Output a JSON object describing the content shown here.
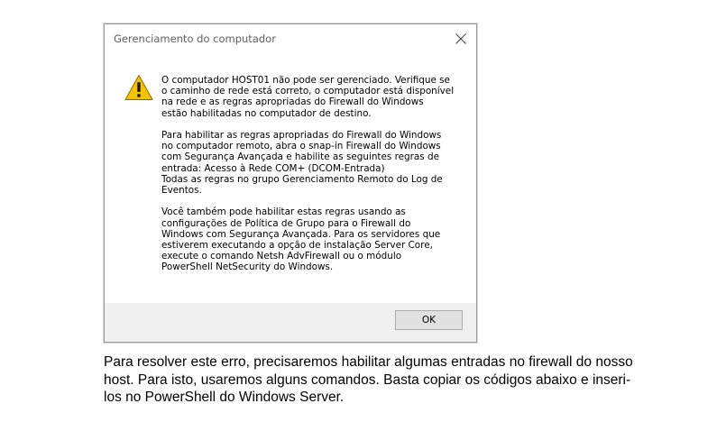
{
  "dialog": {
    "title": "Gerenciamento do computador",
    "icon": "warning-icon",
    "message": {
      "p1": "O computador HOST01 não pode ser gerenciado. Verifique se\no caminho de rede está correto, o computador está disponível\nna rede e as regras apropriadas do Firewall do Windows\nestão habilitadas no computador de destino.",
      "p2": "Para habilitar as regras apropriadas do Firewall do Windows\nno computador remoto, abra o snap-in Firewall do Windows\ncom Segurança Avançada e habilite as seguintes regras de\nentrada: Acesso à Rede COM+ (DCOM-Entrada)\nTodas as regras no grupo Gerenciamento Remoto do Log de\nEventos.",
      "p3": "Você também pode habilitar estas regras usando as\nconfigurações de Política de Grupo para o Firewall do\nWindows com Segurança Avançada. Para os servidores que\nestiverem executando a opção de instalação Server Core,\nexecute o comando Netsh AdvFirewall ou o módulo\nPowerShell NetSecurity do Windows."
    },
    "ok_label": "OK",
    "colors": {
      "warning_fill": "#f5c400",
      "footer_bg": "#f0f0f0",
      "button_bg": "#e1e1e1"
    }
  },
  "caption": {
    "text": "Para resolver este erro, precisaremos habilitar algumas entradas no firewall do nosso host. Para isto, usaremos alguns comandos. Basta copiar os códigos abaixo e inseri-los no PowerShell do Windows Server."
  }
}
